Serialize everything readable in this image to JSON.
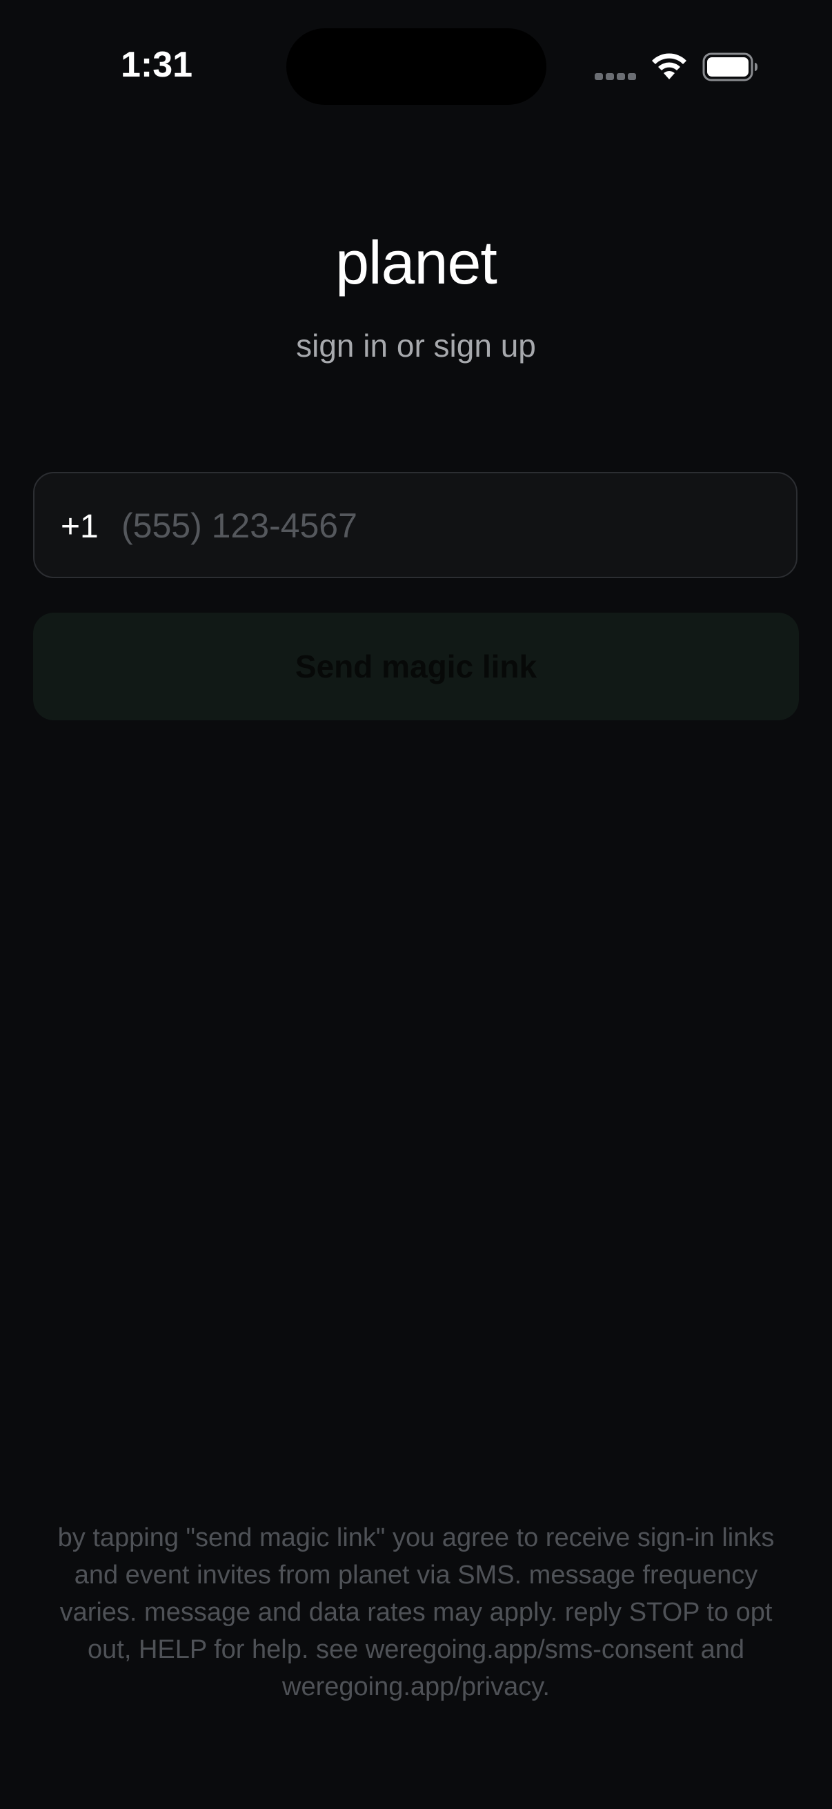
{
  "status_bar": {
    "time": "1:31",
    "signal_icon": "cellular-signal-icon",
    "wifi_icon": "wifi-icon",
    "battery_icon": "battery-icon"
  },
  "header": {
    "title": "planet",
    "subtitle": "sign in or sign up"
  },
  "form": {
    "country_code": "+1",
    "phone_placeholder": "(555) 123-4567",
    "phone_value": "",
    "send_button_label": "Send magic link"
  },
  "footer": {
    "legal_text": "by tapping \"send magic link\" you agree to receive sign-in links and event invites from planet via SMS. message frequency varies. message and data rates may apply. reply STOP to opt out, HELP for help. see weregoing.app/sms-consent and weregoing.app/privacy."
  },
  "colors": {
    "background": "#0a0b0d",
    "field_background": "#111214",
    "button_background": "#111916",
    "muted_text": "#a7a9ad"
  }
}
